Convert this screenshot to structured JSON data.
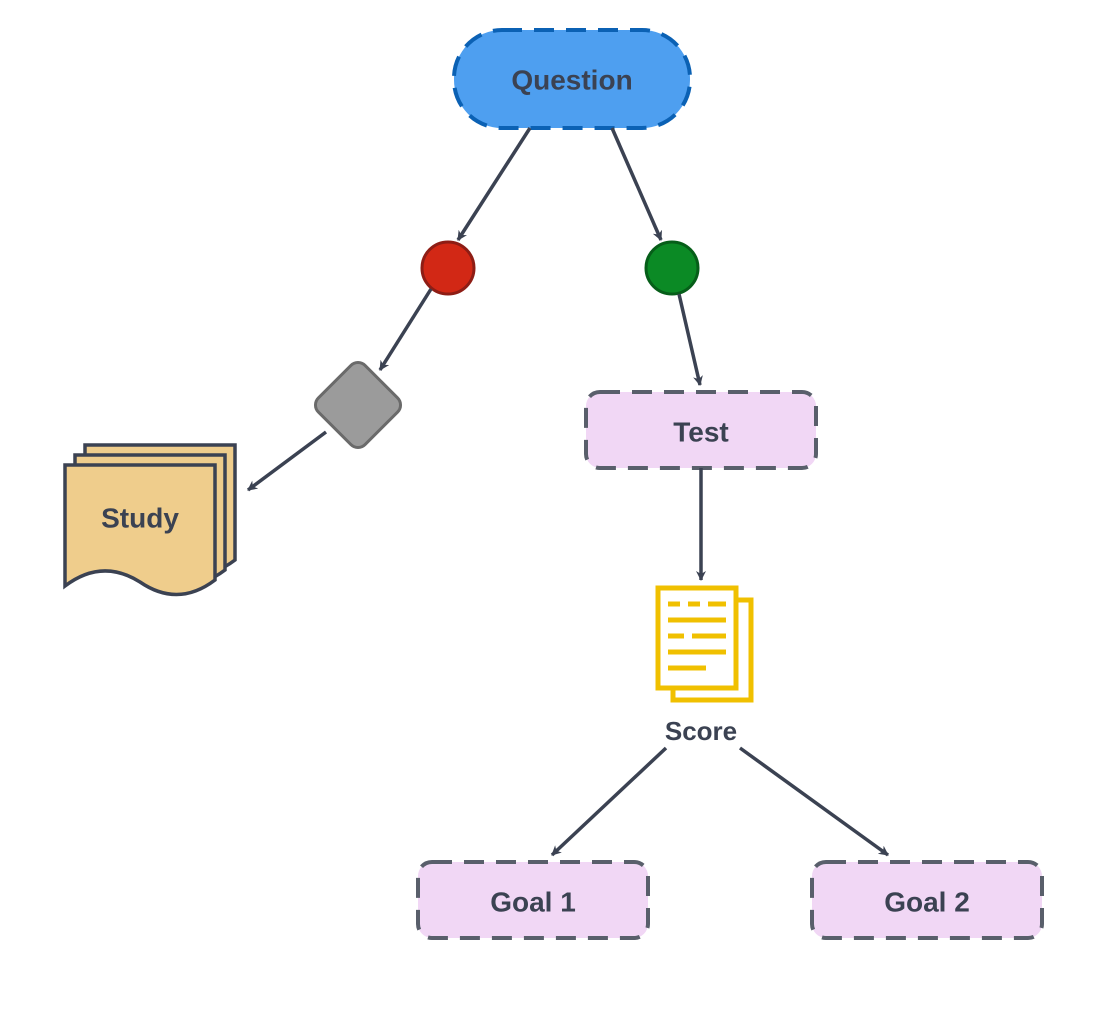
{
  "nodes": {
    "question": {
      "label": "Question"
    },
    "study": {
      "label": "Study"
    },
    "test": {
      "label": "Test"
    },
    "score": {
      "label": "Score"
    },
    "goal1": {
      "label": "Goal 1"
    },
    "goal2": {
      "label": "Goal 2"
    }
  },
  "colors": {
    "question_fill": "#4e9ff0",
    "question_stroke": "#0b61b4",
    "red_dot_fill": "#d22815",
    "red_dot_stroke": "#8e1d15",
    "green_dot_fill": "#0b8a25",
    "green_dot_stroke": "#065e19",
    "gray_diamond_fill": "#9b9b9b",
    "gray_diamond_stroke": "#6a6a6a",
    "pink_fill": "#f1d7f5",
    "pink_stroke": "#595f6b",
    "tan_fill": "#efcd8c",
    "tan_stroke": "#3b4252",
    "gold": "#f0c000",
    "arrow": "#3b4252",
    "text": "#3b4252"
  }
}
